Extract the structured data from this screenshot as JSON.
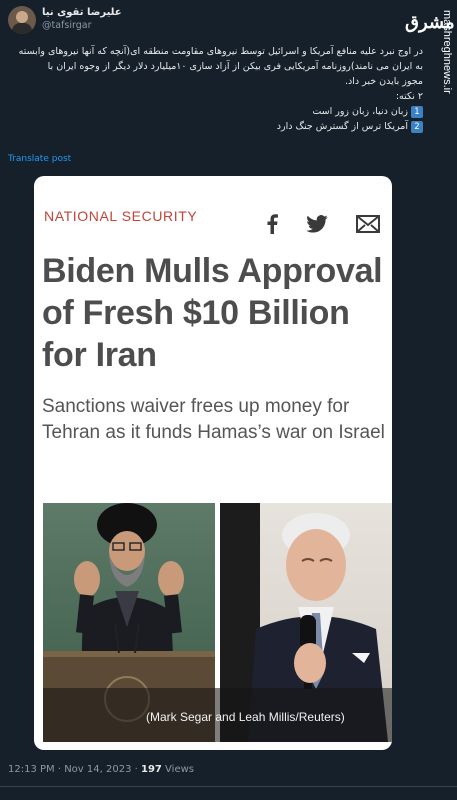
{
  "author": {
    "display_name": "علیرضا تقوی نیا",
    "handle": "@tafsirgar"
  },
  "watermark": {
    "logo_text": "مشرق",
    "url": "mashreghnews.ir"
  },
  "tweet": {
    "lines": [
      "در اوج نبرد علیه منافع آمریکا و اسرائیل توسط نیروهای مقاومت منطقه ای(آنچه که آنها نیروهای وابسته",
      "به ایران می نامند)روزنامه آمریکایی فری بیکن از آزاد سازی ۱۰میلیارد دلار دیگر از وجوه ایران با",
      "مجوز بایدن خبر داد.",
      "۲ نکته:"
    ],
    "points": [
      {
        "num": "1",
        "text": "زبان دنیا، زبان زور است"
      },
      {
        "num": "2",
        "text": "آمریکا ترس از گسترش جنگ دارد"
      }
    ]
  },
  "translate_label": "Translate post",
  "card": {
    "kicker": "NATIONAL SECURITY",
    "share_icons": [
      "facebook-icon",
      "twitter-icon",
      "mail-icon"
    ],
    "headline": "Biden Mulls Approval of Fresh $10 Billion for Iran",
    "subhead": "Sanctions waiver frees up money for Tehran as it funds Hamas’s war on Israel",
    "photo_caption": "(Mark Segar and Leah Millis/Reuters)"
  },
  "meta": {
    "time": "12:13 PM",
    "date": "Nov 14, 2023",
    "views_count": "197",
    "views_label": "Views"
  },
  "colors": {
    "background": "#15202b",
    "kicker": "#c0453a",
    "link": "#1d9bf0"
  }
}
